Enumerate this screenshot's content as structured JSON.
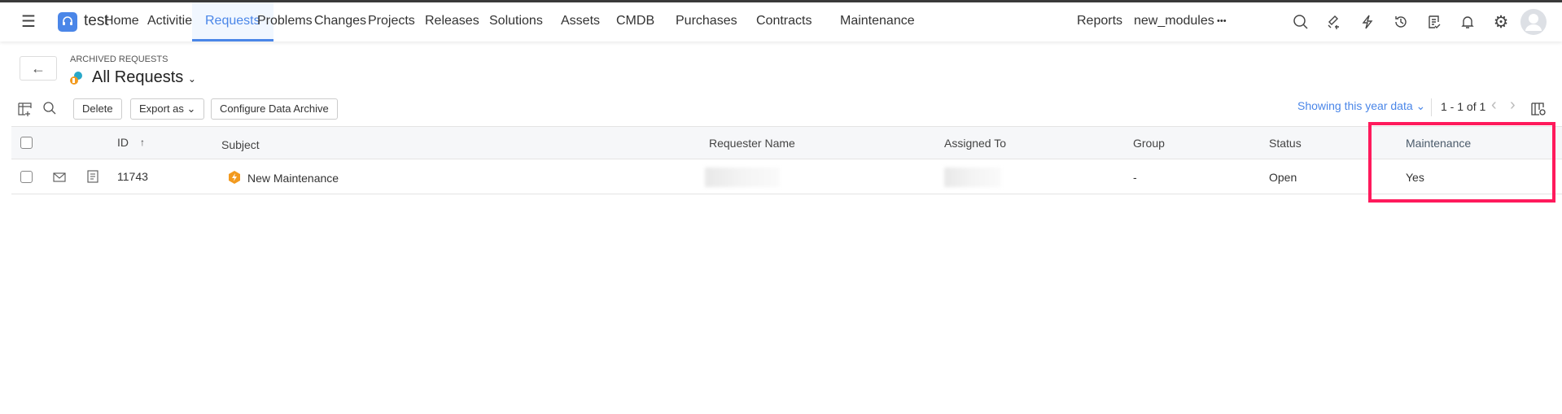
{
  "app": {
    "name": "test"
  },
  "nav": {
    "items": [
      "Home",
      "Activities",
      "Requests",
      "Problems",
      "Changes",
      "Projects",
      "Releases",
      "Solutions",
      "Assets",
      "CMDB",
      "Purchases",
      "Contracts",
      "Maintenance",
      "Reports",
      "new_modules"
    ],
    "more": "•••",
    "active": "Requests"
  },
  "header": {
    "breadcrumb": "ARCHIVED REQUESTS",
    "title": "All Requests"
  },
  "toolbar": {
    "delete": "Delete",
    "export": "Export as",
    "configure": "Configure Data Archive",
    "filter": "Showing this year data",
    "pagination": "1 - 1 of 1"
  },
  "table": {
    "columns": [
      "ID",
      "Subject",
      "Requester Name",
      "Assigned To",
      "Group",
      "Status",
      "Maintenance"
    ],
    "rows": [
      {
        "id": "11743",
        "subject": "New Maintenance",
        "requester": "",
        "assigned_to": "",
        "group": "-",
        "status": "Open",
        "maintenance": "Yes"
      }
    ]
  },
  "colors": {
    "accent": "#4a86e8",
    "highlight": "#ff1a5c"
  }
}
